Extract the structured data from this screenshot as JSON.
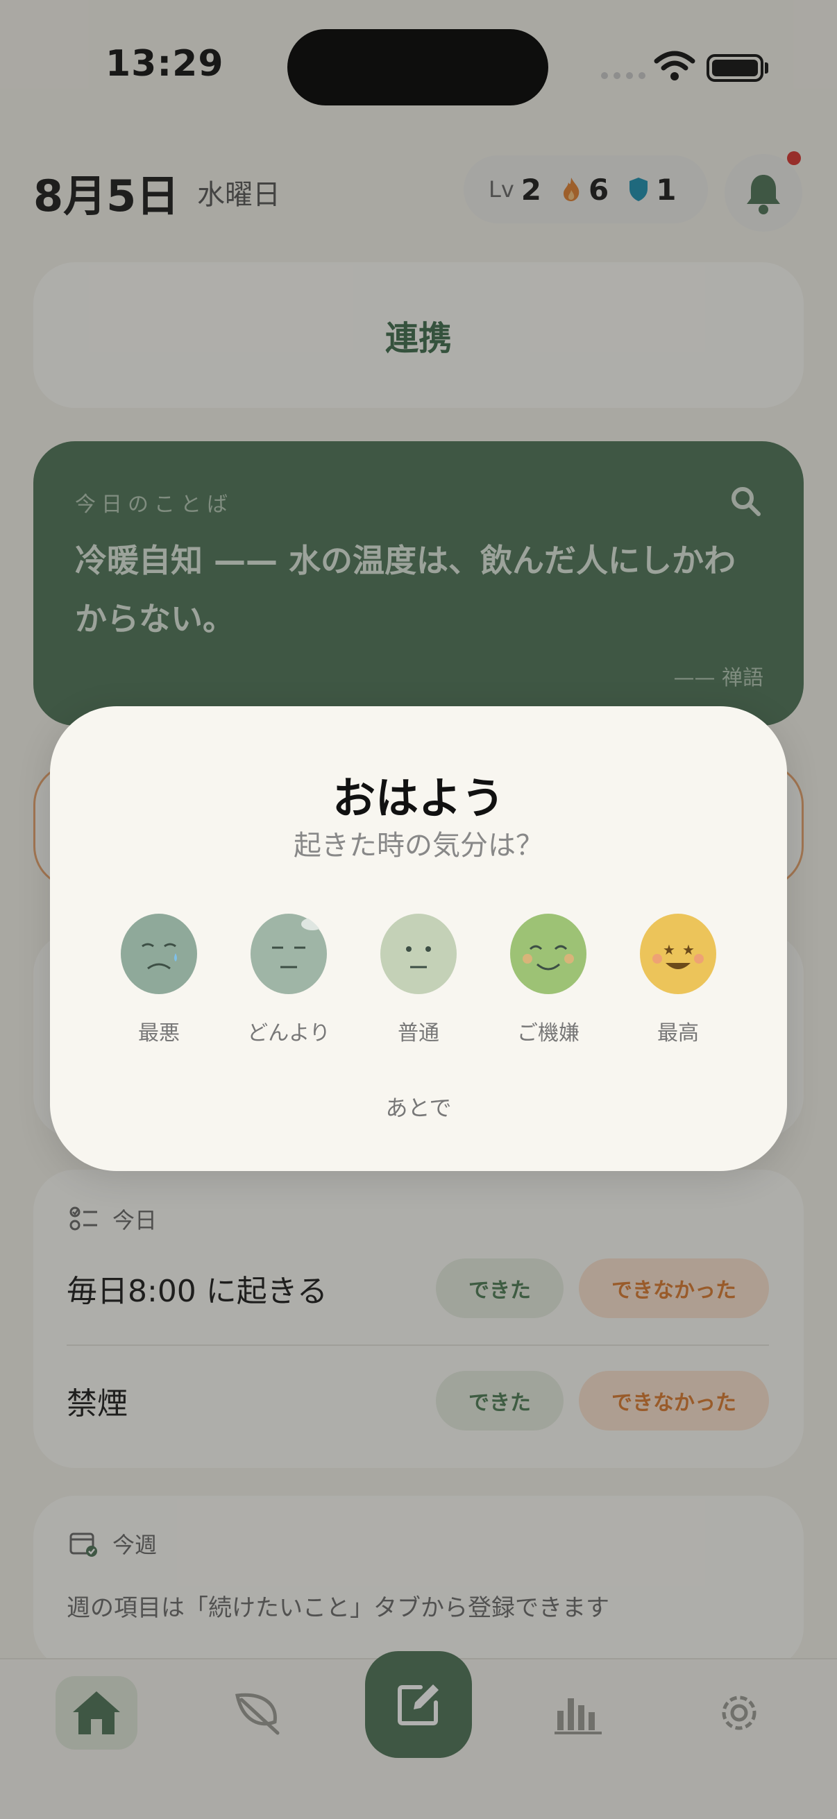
{
  "status": {
    "time": "13:29"
  },
  "header": {
    "date": "8月5日",
    "weekday": "水曜日",
    "level_label": "Lv",
    "level": "2",
    "streak": "6",
    "shield": "1"
  },
  "renkei": {
    "label": "連携"
  },
  "quote": {
    "label": "今日のことば",
    "text": "冷暖自知 —— 水の温度は、飲んだ人にしかわからない。",
    "source": "—— 禅語"
  },
  "today": {
    "title": "今日",
    "habits": [
      {
        "name": "毎日8:00 に起きる",
        "done": "できた",
        "fail": "できなかった"
      },
      {
        "name": "禁煙",
        "done": "できた",
        "fail": "できなかった"
      }
    ]
  },
  "week": {
    "title": "今週",
    "text": "週の項目は「続けたいこと」タブから登録できます"
  },
  "modal": {
    "title": "おはよう",
    "subtitle": "起きた時の気分は？",
    "moods": [
      {
        "label": "最悪",
        "color": "#8fa99a"
      },
      {
        "label": "どんより",
        "color": "#9fb5a6"
      },
      {
        "label": "普通",
        "color": "#c4d1b7"
      },
      {
        "label": "ご機嫌",
        "color": "#9dc275"
      },
      {
        "label": "最高",
        "color": "#ecc45a"
      }
    ],
    "later": "あとで"
  },
  "colors": {
    "accent": "#4e7356",
    "orange": "#d9792e"
  }
}
